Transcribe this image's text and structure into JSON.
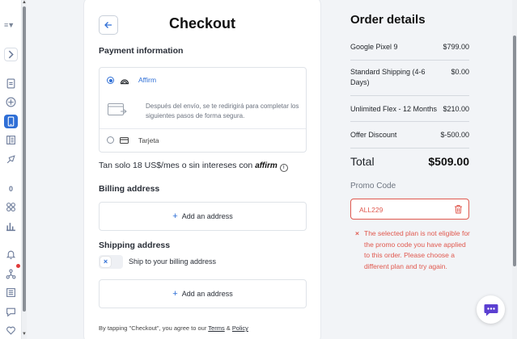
{
  "rail": {
    "logo": "≡▼",
    "items": [
      {
        "name": "expand-icon",
        "glyph": "›"
      },
      {
        "name": "document-icon"
      },
      {
        "name": "add-circle-icon"
      },
      {
        "name": "phone-icon"
      },
      {
        "name": "catalog-icon"
      },
      {
        "name": "rocket-icon"
      },
      {
        "name": "count-badge",
        "label": "0"
      },
      {
        "name": "grid-icon"
      },
      {
        "name": "chart-icon"
      },
      {
        "name": "bell-icon"
      },
      {
        "name": "network-icon"
      },
      {
        "name": "list-icon"
      },
      {
        "name": "chat-icon"
      },
      {
        "name": "heart-icon"
      }
    ]
  },
  "checkout": {
    "title": "Checkout",
    "payment_label": "Payment information",
    "options": {
      "affirm": "Affirm",
      "note": "Después del envío, se te redirigirá para completar los siguientes pasos de forma segura.",
      "card": "Tarjeta"
    },
    "affirm_promo": "Tan solo 18 US$/mes o sin intereses con",
    "affirm_logo": "affirm",
    "billing_label": "Billing address",
    "add_address": "Add an address",
    "shipping_label": "Shipping address",
    "ship_toggle_label": "Ship to your billing address",
    "toggle_mark": "×",
    "terms_prefix": "By tapping \"Checkout\", you agree to our",
    "terms_link": "Terms",
    "terms_amp": "&",
    "policy_link": "Policy"
  },
  "order": {
    "title": "Order details",
    "rows": [
      {
        "name": "Google Pixel 9",
        "price": "$799.00"
      },
      {
        "name": "Standard Shipping (4-6 Days)",
        "price": "$0.00"
      },
      {
        "name": "Unlimited Flex - 12 Months",
        "price": "$210.00"
      },
      {
        "name": "Offer Discount",
        "price": "$-500.00"
      }
    ],
    "total_label": "Total",
    "total_value": "$509.00",
    "promo_label": "Promo Code",
    "promo_value": "ALL229",
    "error_mark": "×",
    "error_msg": "The selected plan is not eligible for the promo code you have applied to this order. Please choose a different plan and try again."
  },
  "colors": {
    "accent": "#2f6fd6",
    "error": "#e0584e",
    "chat": "#5b3fd1"
  }
}
